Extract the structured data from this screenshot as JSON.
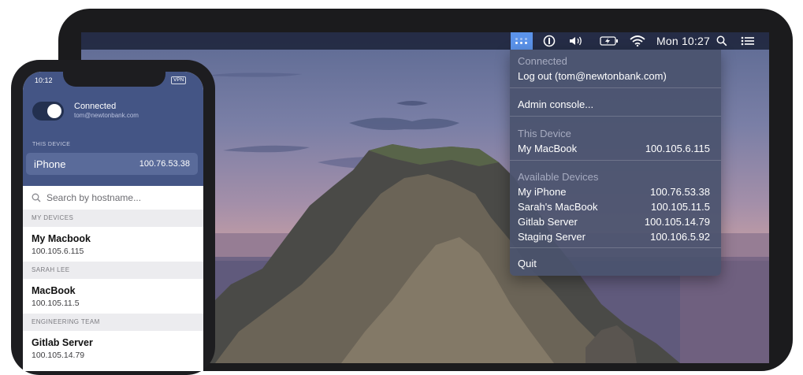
{
  "mac": {
    "menubar": {
      "clock": "Mon 10:27"
    },
    "menu": {
      "connected_header": "Connected",
      "logout": "Log out (tom@newtonbank.com)",
      "admin": "Admin console...",
      "this_device_header": "This Device",
      "this_device": {
        "name": "My MacBook",
        "ip": "100.105.6.115"
      },
      "available_header": "Available Devices",
      "available": [
        {
          "name": "My iPhone",
          "ip": "100.76.53.38"
        },
        {
          "name": "Sarah's MacBook",
          "ip": "100.105.11.5"
        },
        {
          "name": "Gitlab Server",
          "ip": "100.105.14.79"
        },
        {
          "name": "Staging Server",
          "ip": "100.106.5.92"
        }
      ],
      "quit": "Quit"
    }
  },
  "phone": {
    "status": {
      "time": "10:12",
      "vpn": "VPN"
    },
    "connection": {
      "status": "Connected",
      "account": "tom@newtonbank.com",
      "toggle_on": true
    },
    "this_device_header": "THIS DEVICE",
    "this_device": {
      "name": "iPhone",
      "ip": "100.76.53.38"
    },
    "search_placeholder": "Search by hostname...",
    "sections": [
      {
        "title": "MY DEVICES",
        "items": [
          {
            "name": "My Macbook",
            "ip": "100.105.6.115"
          }
        ]
      },
      {
        "title": "SARAH LEE",
        "items": [
          {
            "name": "MacBook",
            "ip": "100.105.11.5"
          }
        ]
      },
      {
        "title": "ENGINEERING TEAM",
        "items": [
          {
            "name": "Gitlab Server",
            "ip": "100.105.14.79"
          }
        ]
      }
    ]
  }
}
